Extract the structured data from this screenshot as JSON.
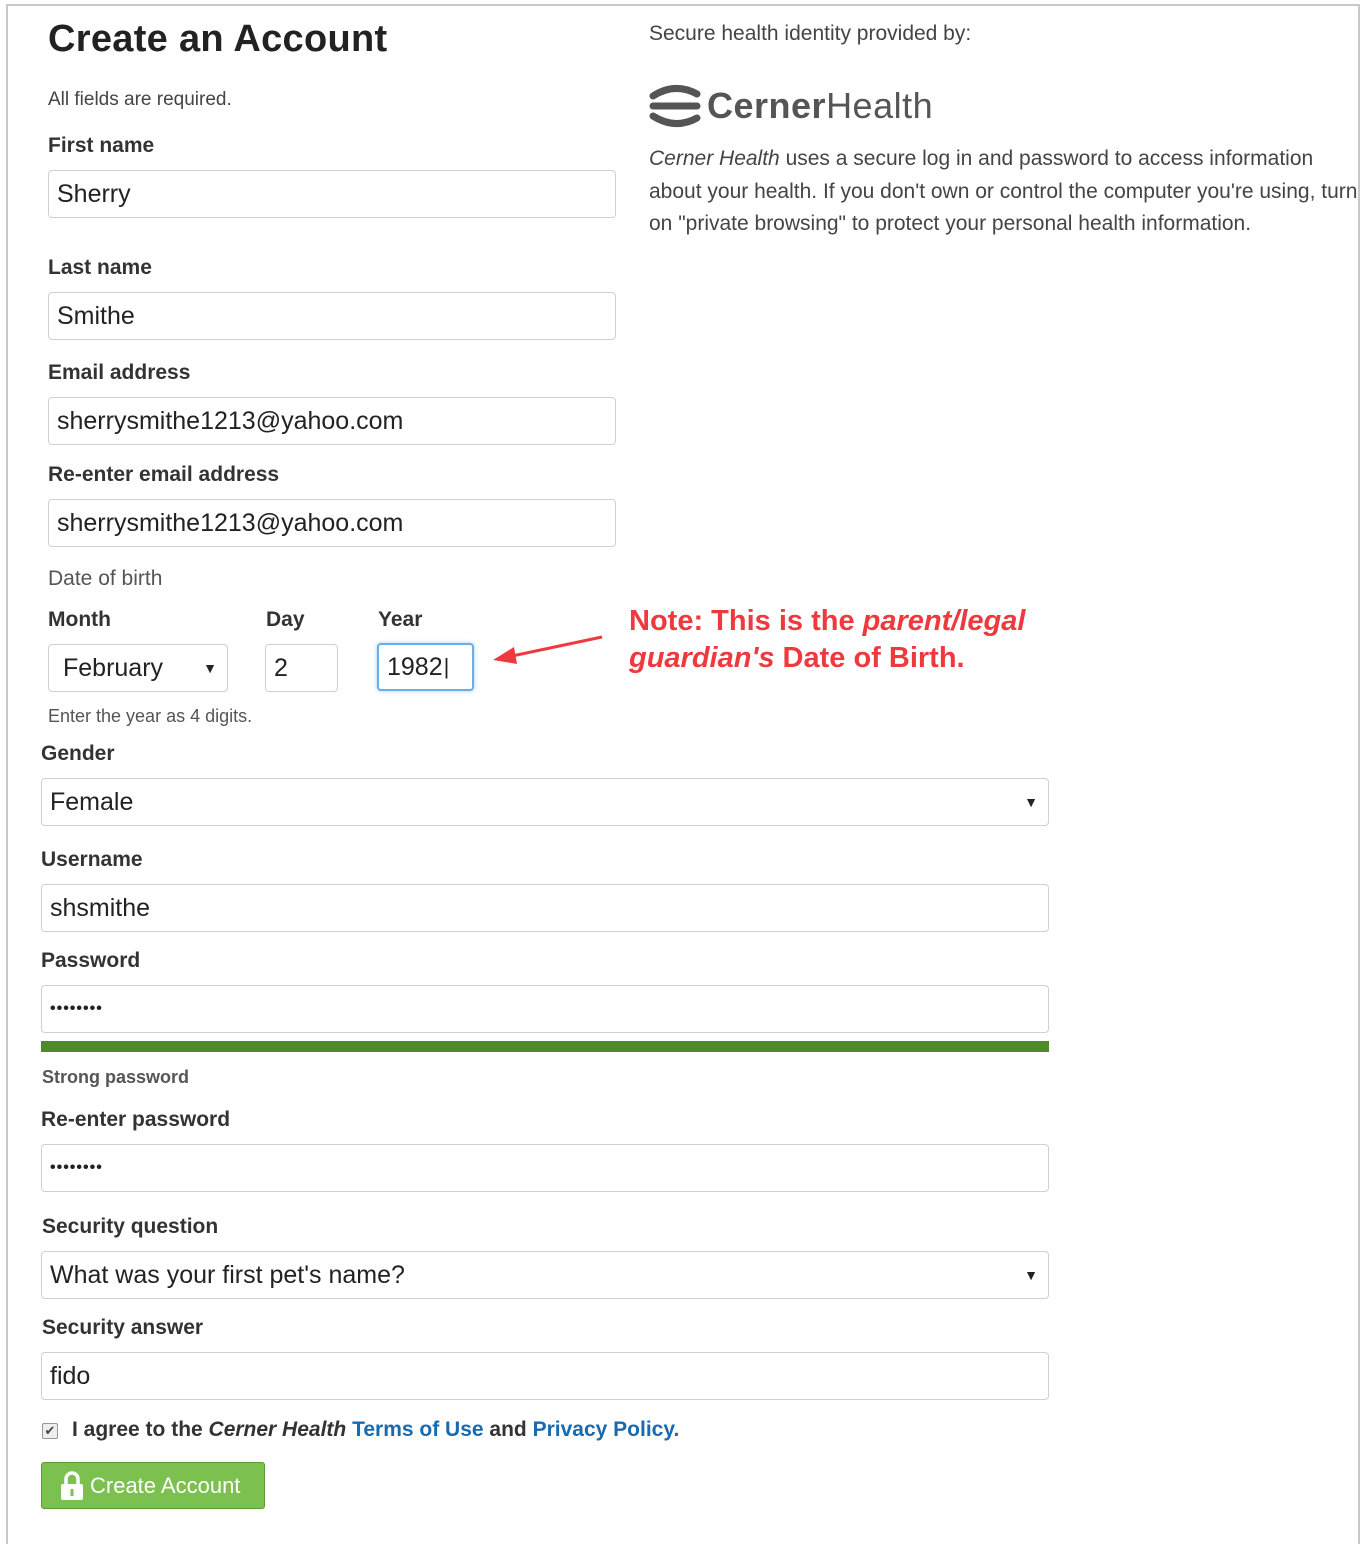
{
  "page": {
    "title": "Create an Account",
    "required_note": "All fields are required."
  },
  "form": {
    "first_name": {
      "label": "First name",
      "value": "Sherry"
    },
    "last_name": {
      "label": "Last name",
      "value": "Smithe"
    },
    "email": {
      "label": "Email address",
      "value": "sherrysmithe1213@yahoo.com"
    },
    "email_confirm": {
      "label": "Re-enter email address",
      "value": "sherrysmithe1213@yahoo.com"
    },
    "dob": {
      "heading": "Date of birth",
      "month_label": "Month",
      "month_value": "February",
      "day_label": "Day",
      "day_value": "2",
      "year_label": "Year",
      "year_value": "1982",
      "hint": "Enter the year as 4 digits."
    },
    "gender": {
      "label": "Gender",
      "value": "Female"
    },
    "username": {
      "label": "Username",
      "value": "shsmithe"
    },
    "password": {
      "label": "Password",
      "value": "••••••••",
      "strength_text": "Strong password",
      "strength_fraction": 1.0,
      "strength_color": "#4d8a2c"
    },
    "password_confirm": {
      "label": "Re-enter password",
      "value": "••••••••"
    },
    "security_question": {
      "label": "Security question",
      "value": "What was your first pet's name?"
    },
    "security_answer": {
      "label": "Security answer",
      "value": "fido"
    },
    "agree": {
      "checked": true,
      "prefix": "I agree to the ",
      "brand": "Cerner Health",
      "space": " ",
      "terms_link": "Terms of Use",
      "and": " and ",
      "privacy_link": "Privacy Policy",
      "period": "."
    },
    "submit_label": "Create Account",
    "submit_color": "#7cc04f"
  },
  "sidebar": {
    "provided_by": "Secure health identity provided by:",
    "logo_text_bold": "Cerner",
    "logo_text_regular": "Health",
    "desc_brand": "Cerner Health",
    "desc_text": " uses a secure log in and password to access information about your health. If you don't own or control the computer you're using, turn on \"private browsing\" to protect your personal health information."
  },
  "annotation": {
    "note_prefix": "Note: This is the ",
    "note_italic": "parent/legal guardian's",
    "note_suffix": " Date of Birth.",
    "color": "#ee3a3f"
  }
}
